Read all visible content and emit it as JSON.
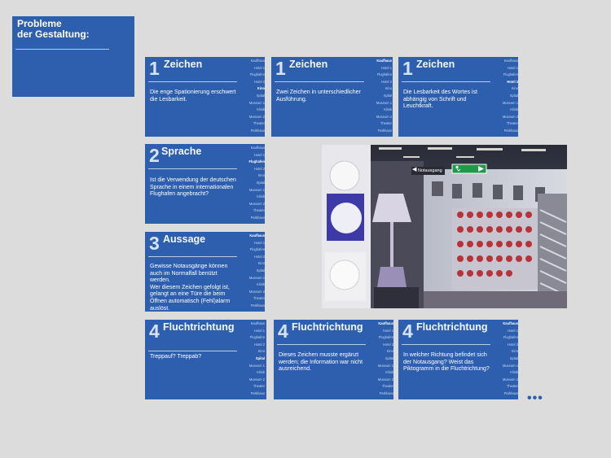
{
  "header": {
    "line1": "Probleme",
    "line2": "der Gestaltung:"
  },
  "cards": [
    {
      "num": "1",
      "title": "Zeichen",
      "text": [
        "Die enge Spationierung erschwert",
        "die Lesbarkeit."
      ],
      "active": 4
    },
    {
      "num": "1",
      "title": "Zeichen",
      "text": [
        "Zwei Zeichen in unterschiedlicher",
        "Ausführung."
      ],
      "active": 0
    },
    {
      "num": "1",
      "title": "Zeichen",
      "text": [
        "Die Lesbarkeit des Wortes ist",
        "abhängig von Schrift und",
        "Leuchtkraft."
      ],
      "active": 3
    },
    {
      "num": "2",
      "title": "Sprache",
      "text": [
        "Ist die Verwendung der deutschen",
        "Sprache in einem internationalen",
        "Flughafen angebracht?"
      ],
      "active": 2
    },
    {
      "num": "3",
      "title": "Aussage",
      "text": [
        "Gewisse Notausgänge können",
        "auch im Normalfall benützt werden.",
        "Wer diesem Zeichen gefolgt ist,",
        "gelangt an eine Türe die beim",
        "Öffnen automatisch (Fehl)alarm",
        "auslöst."
      ],
      "active": 0
    },
    {
      "num": "4",
      "title": "Fluchtrichtung",
      "text": [
        "Treppauf? Treppab?"
      ],
      "active": 5
    },
    {
      "num": "4",
      "title": "Fluchtrichtung",
      "text": [
        "Dieses Zeichen musste ergänzt",
        "werden; die Information war nicht",
        "ausreichend."
      ],
      "active": 0
    },
    {
      "num": "4",
      "title": "Fluchtrichtung",
      "text": [
        "In welcher Richtung befindet sich",
        "der Notausgang? Weist das",
        "Piktogramm in die Fluchtrichtung?"
      ],
      "active": 0
    }
  ],
  "sidebar_items": [
    "Kaufhaus",
    "Hotel 1",
    "Flughafen",
    "Hotel 2",
    "Kino",
    "Spital",
    "Museum 1",
    "Klinik",
    "Museum 2",
    "Theater",
    "Parkhaus"
  ],
  "photo": {
    "exit_sign": "Notausgang"
  },
  "more": "•••",
  "colors": {
    "card_blue": "#2e5fae",
    "background": "#dcdcdc",
    "exit_green": "#1f9a4a"
  }
}
